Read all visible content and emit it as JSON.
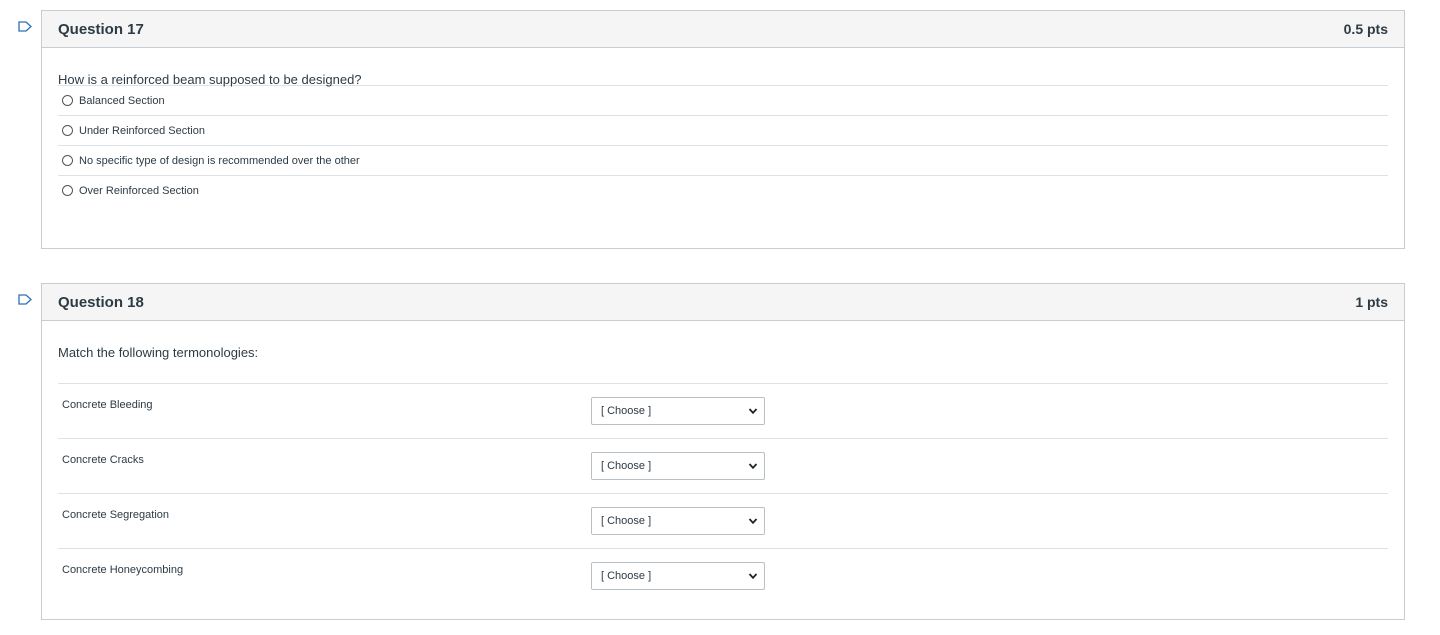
{
  "question17": {
    "title": "Question 17",
    "points": "0.5 pts",
    "text": "How is a reinforced beam supposed to be designed?",
    "answers": [
      {
        "label": "Balanced Section"
      },
      {
        "label": "Under Reinforced Section"
      },
      {
        "label": "No specific type of design is recommended over the other"
      },
      {
        "label": "Over Reinforced Section"
      }
    ]
  },
  "question18": {
    "title": "Question 18",
    "points": "1 pts",
    "text": "Match the following termonologies:",
    "rows": [
      {
        "label": "Concrete Bleeding",
        "selected": "[ Choose ]"
      },
      {
        "label": "Concrete Cracks",
        "selected": "[ Choose ]"
      },
      {
        "label": "Concrete Segregation",
        "selected": "[ Choose ]"
      },
      {
        "label": "Concrete Honeycombing",
        "selected": "[ Choose ]"
      }
    ]
  },
  "colors": {
    "flag": "#2d6fb5",
    "header_bg": "#f5f5f5",
    "border": "#c7cdd1"
  }
}
